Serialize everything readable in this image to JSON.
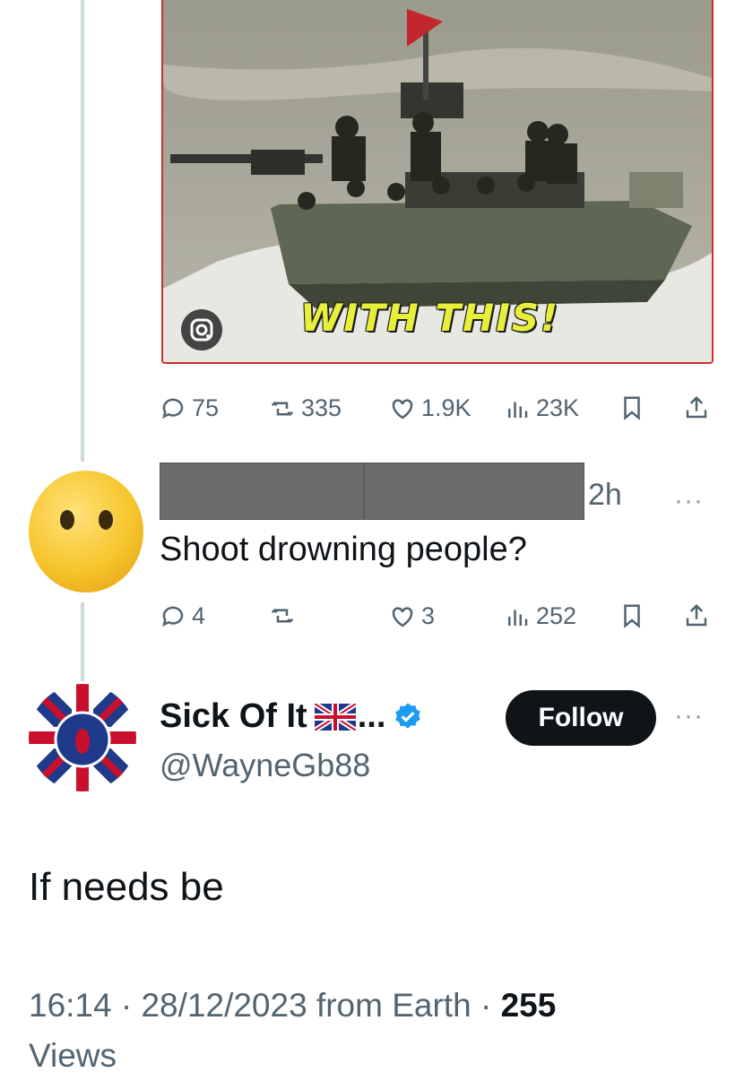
{
  "media": {
    "caption": "WITH THIS!",
    "lens_icon": "google-lens-icon"
  },
  "original_post_actions": {
    "replies": "75",
    "reposts": "335",
    "likes": "1.9K",
    "views": "23K"
  },
  "reply": {
    "time": "2h",
    "more": "···",
    "text": "Shoot drowning people?",
    "avatar_icon": "face-without-mouth-emoji",
    "actions": {
      "replies": "4",
      "reposts": "",
      "likes": "3",
      "views": "252"
    }
  },
  "main_post": {
    "display_name": "Sick Of It",
    "name_suffix": "...",
    "flag_icon": "union-jack-flag-icon",
    "verified_icon": "verified-badge-icon",
    "handle": "@WayneGb88",
    "follow_label": "Follow",
    "more": "···",
    "text": "If needs be",
    "time": "16:14",
    "date": "28/12/2023",
    "source": "from Earth",
    "views_count": "255",
    "views_label": "Views"
  },
  "colors": {
    "accent": "#1d9bf0",
    "text": "#0f1419",
    "muted": "#536471",
    "follow_bg": "#0f1419"
  }
}
